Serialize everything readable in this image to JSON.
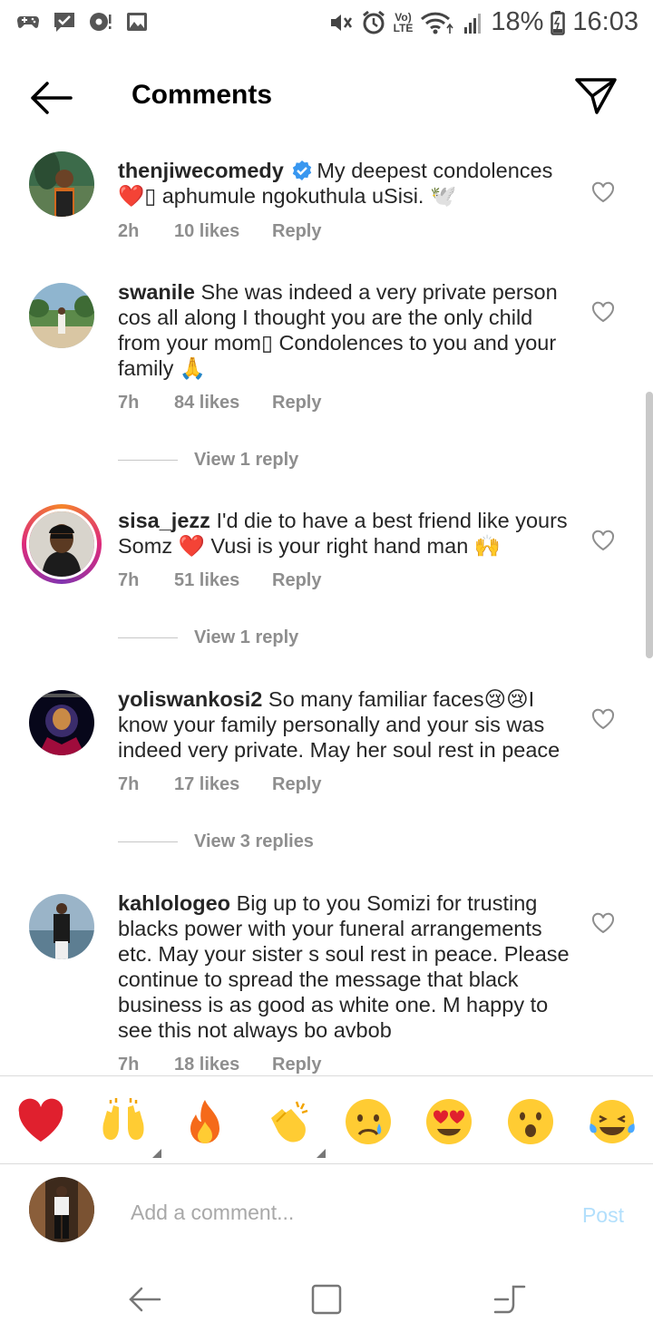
{
  "status_bar": {
    "battery_percent": "18%",
    "time": "16:03",
    "volte_top": "Vo)",
    "volte_bottom": "LTE"
  },
  "header": {
    "title": "Comments"
  },
  "comments": [
    {
      "username": "thenjiwecomedy",
      "verified": true,
      "text_1": "My deepest condolences",
      "text_2": "❤️▯ aphumule ngokuthula uSisi. 🕊️",
      "time": "2h",
      "likes": "10 likes",
      "reply": "Reply"
    },
    {
      "username": "swanile",
      "text": "She was indeed a very private person cos all along I thought you are the only child from your mom▯ Condolences to you and your family 🙏",
      "time": "7h",
      "likes": "84 likes",
      "reply": "Reply",
      "view_replies": "View 1 reply"
    },
    {
      "username": "sisa_jezz",
      "text": "I'd die to have a best friend like yours Somz ❤️ Vusi is your right hand man 🙌",
      "time": "7h",
      "likes": "51 likes",
      "reply": "Reply",
      "view_replies": "View 1 reply"
    },
    {
      "username": "yoliswankosi2",
      "text": "So many familiar faces😢😢I know your family personally and your sis was indeed very private. May her soul rest in peace",
      "time": "7h",
      "likes": "17 likes",
      "reply": "Reply",
      "view_replies": "View 3 replies"
    },
    {
      "username": "kahlologeo",
      "text": "Big up to you Somizi for trusting blacks power with your funeral arrangements etc. May your sister s soul rest in peace. Please continue to spread the message that black business is as good as white one. M happy to see this not always bo avbob",
      "time": "7h",
      "likes": "18 likes",
      "reply": "Reply"
    }
  ],
  "emoji_bar": [
    {
      "icon": "red-heart-emoji"
    },
    {
      "icon": "raising-hands-emoji",
      "has_variants": true
    },
    {
      "icon": "fire-emoji"
    },
    {
      "icon": "clapping-hands-emoji",
      "has_variants": true
    },
    {
      "icon": "crying-face-emoji"
    },
    {
      "icon": "heart-eyes-emoji"
    },
    {
      "icon": "surprised-face-emoji"
    },
    {
      "icon": "tears-of-joy-emoji"
    }
  ],
  "composer": {
    "placeholder": "Add a comment...",
    "post_label": "Post"
  },
  "colors": {
    "username": "#262626",
    "meta": "#8e8e8e",
    "post_disabled": "#b2dffc",
    "verified": "#3897f0",
    "heart": "#e0202e"
  }
}
